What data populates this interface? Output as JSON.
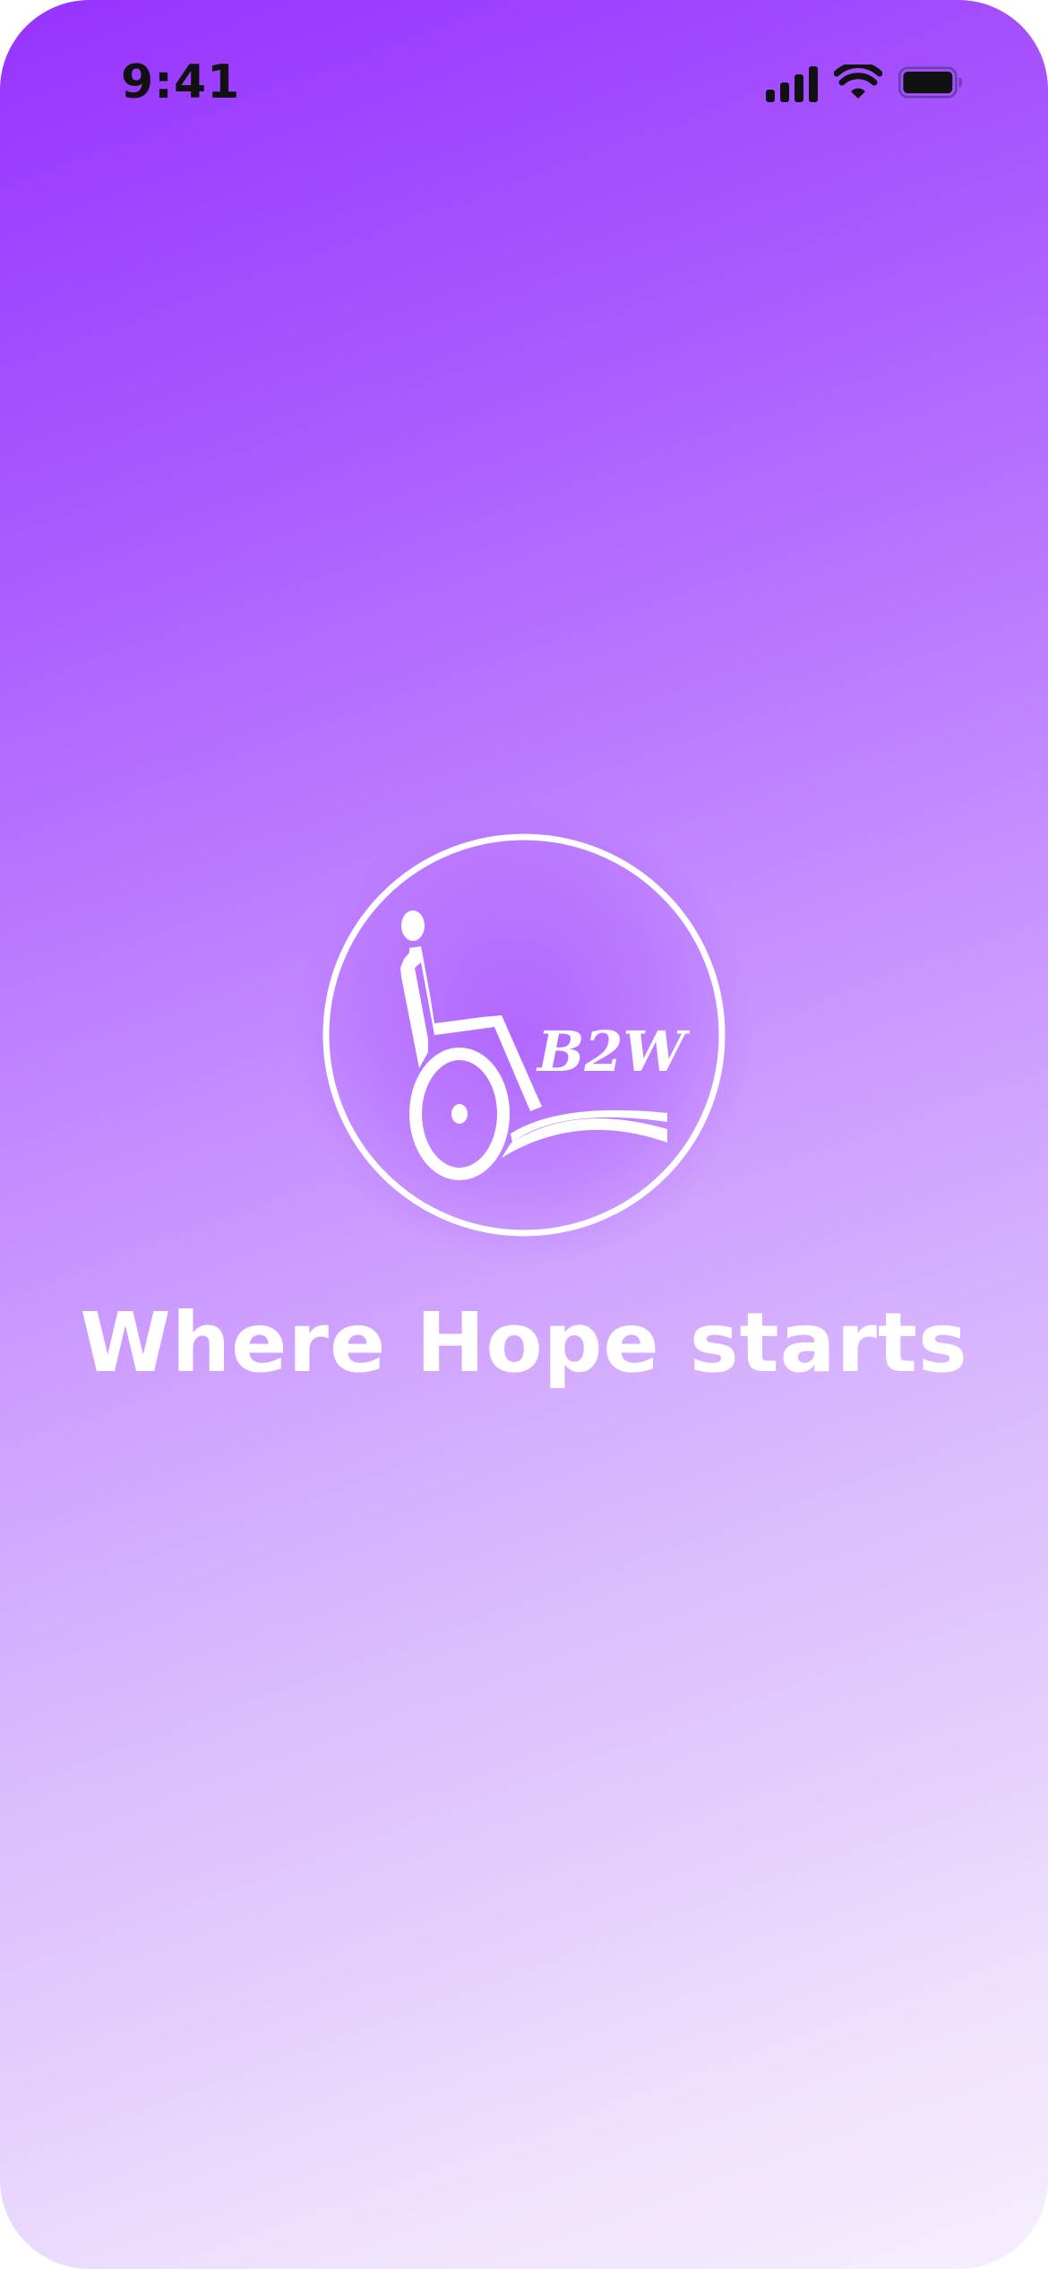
{
  "status_bar": {
    "time": "9:41",
    "icons": [
      "signal-icon",
      "wifi-icon",
      "battery-icon"
    ]
  },
  "logo": {
    "icon": "wheelchair-logo-icon",
    "text": "B2W"
  },
  "tagline": "Where Hope starts",
  "colors": {
    "gradient_top": "#9633ff",
    "gradient_bottom": "#f6eefd",
    "foreground": "#ffffff",
    "status_text": "#111111"
  }
}
